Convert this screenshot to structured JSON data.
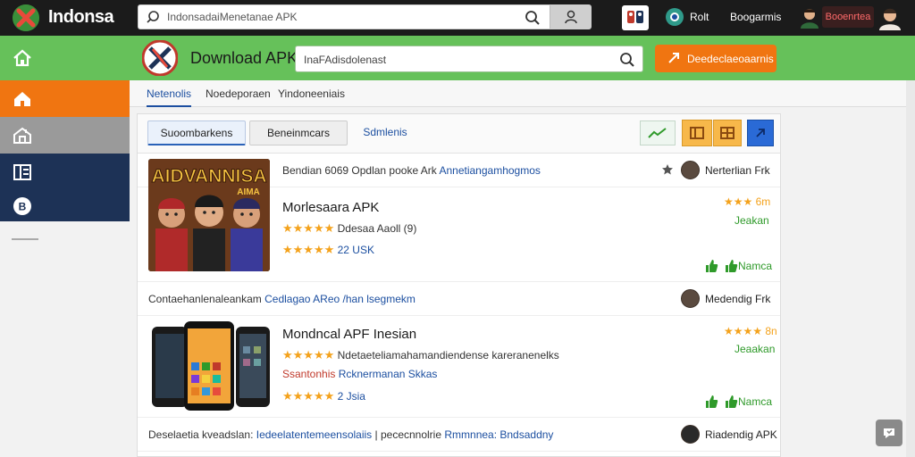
{
  "brand": {
    "name": "Indonsa"
  },
  "top_search": {
    "value": "IndonsadaiMenetanae APK"
  },
  "top_links": {
    "link1": "Rolt",
    "link2": "Boogarmis"
  },
  "top_badge": {
    "label": "Booenrtea"
  },
  "app": {
    "title": "Download APK"
  },
  "main_search": {
    "value": "InaFAdisdolenast"
  },
  "download_button": {
    "label": "Deedeclaeoaarnis"
  },
  "tabs": [
    {
      "label": "Netenolis"
    },
    {
      "label": "Noedeporaen"
    },
    {
      "label": "Yindoneeniais"
    }
  ],
  "filters": [
    {
      "label": "Suoombarkens"
    },
    {
      "label": "Beneinmcars"
    },
    {
      "label": "Sdmlenis"
    }
  ],
  "thumb1": {
    "caption_line1": "AIDVANNISA",
    "caption_line2": "AIMA"
  },
  "items": [
    {
      "header": "Bendian 6069 Opdlan pooke Ark",
      "header_link": "Annetiangamhogmos",
      "user": "Nerterlian Frk",
      "title": "Morlesaara APK",
      "line1_stars": "★★★★★",
      "line1_text": "Ddesaa Aaoll (9)",
      "line2_stars": "★★★★★",
      "line2_text": "22 USK",
      "rating_stars": "★★★",
      "rating_value": "6m",
      "status": "Jeakan",
      "action": "Namca"
    },
    {
      "header": "Contaehanlenaleankam",
      "header_link": "Cedlagao AReo",
      "header_tail": "/han lsegmekm",
      "user": "Medendig Frk",
      "title": "Mondncal APF Inesian",
      "line1_stars": "★★★★★",
      "line1_text": "Ndetaeteliamahamandiendense kareranenelks",
      "line2_red": "Ssantonhis",
      "line2_blue": "Rcknermanan Skkas",
      "line3_stars": "★★★★★",
      "line3_text": "2 Jsia",
      "rating_stars": "★★★★",
      "rating_value": "8n",
      "status": "Jeaakan",
      "action": "Namca"
    },
    {
      "header": "Deselaetia kveadslan:",
      "header_link": "Iedeelatentemeensolaiis",
      "header_mid": "| pececnnolrie",
      "header_link2": "Rmmnnea: Bndsaddny",
      "user": "Riadendig APK"
    }
  ],
  "colors": {
    "green": "#66c15a",
    "orange": "#f07511",
    "navy": "#1d3256",
    "link_blue": "#1c4fa0",
    "star_gold": "#f4a21c"
  },
  "icons": [
    "logo-icon",
    "search-icon",
    "user-icon",
    "app-icon",
    "globe-icon",
    "home-icon",
    "shop-icon",
    "grid-icon",
    "coin-icon",
    "download-icon",
    "chart-icon",
    "star-icon",
    "thumbs-up-icon",
    "help-icon"
  ]
}
